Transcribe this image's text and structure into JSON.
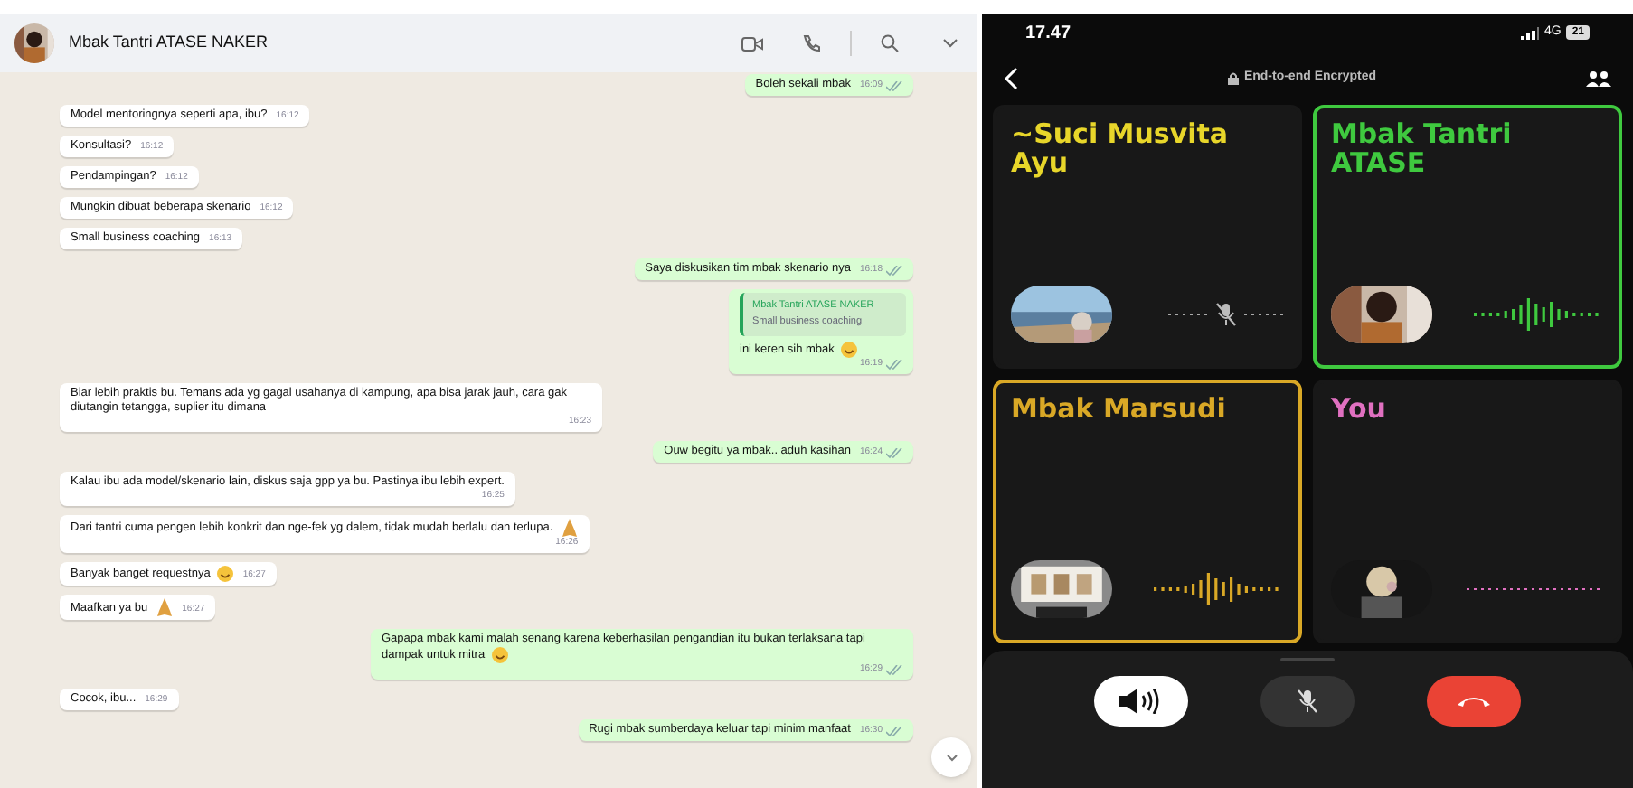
{
  "chat": {
    "title": "Mbak Tantri ATASE NAKER",
    "messages": [
      {
        "kind": "out",
        "text": "Boleh sekali mbak",
        "time": "16:09",
        "read": true
      },
      {
        "kind": "in",
        "text": "Model mentoringnya seperti apa, ibu?",
        "time": "16:12"
      },
      {
        "kind": "in",
        "text": "Konsultasi?",
        "time": "16:12"
      },
      {
        "kind": "in",
        "text": "Pendampingan?",
        "time": "16:12"
      },
      {
        "kind": "in",
        "text": "Mungkin dibuat beberapa skenario",
        "time": "16:12"
      },
      {
        "kind": "in",
        "text": "Small business coaching",
        "time": "16:13"
      },
      {
        "kind": "out",
        "text": "Saya diskusikan tim mbak skenario nya",
        "time": "16:18",
        "read": true
      },
      {
        "kind": "out",
        "quote_author": "Mbak Tantri ATASE NAKER",
        "quote": "Small business coaching",
        "text": "ini keren sih mbak",
        "emoji": {
          "kind": "smile"
        },
        "time": "16:19",
        "read": true
      },
      {
        "kind": "in",
        "text": "Biar lebih praktis bu. Temans ada yg gagal usahanya di kampung, apa bisa jarak jauh, cara gak diutangin tetangga, suplier itu dimana",
        "time": "16:23"
      },
      {
        "kind": "out",
        "text": "Ouw begitu ya mbak.. aduh kasihan",
        "time": "16:24",
        "read": true
      },
      {
        "kind": "in",
        "text": "Kalau ibu ada model/skenario lain, diskus saja gpp ya bu. Pastinya ibu lebih expert.",
        "time": "16:25"
      },
      {
        "kind": "in",
        "text": "Dari tantri cuma pengen lebih konkrit dan nge-fek yg dalem, tidak mudah berlalu dan terlupa.",
        "emoji": {
          "kind": "pray"
        },
        "time": "16:26"
      },
      {
        "kind": "in",
        "text": "Banyak banget requestnya",
        "emoji": {
          "kind": "smile"
        },
        "time": "16:27"
      },
      {
        "kind": "in",
        "text": "Maafkan ya bu",
        "emoji": {
          "kind": "pray"
        },
        "time": "16:27"
      },
      {
        "kind": "out",
        "text": "Gapapa mbak kami malah senang karena keberhasilan pengandian itu bukan terlaksana tapi dampak untuk mitra",
        "emoji": {
          "kind": "smile"
        },
        "time": "16:29",
        "read": true
      },
      {
        "kind": "in",
        "text": "Cocok, ibu...",
        "time": "16:29"
      },
      {
        "kind": "out",
        "text": "Rugi mbak sumberdaya keluar tapi minim manfaat",
        "time": "16:30",
        "read": true
      }
    ]
  },
  "call": {
    "time": "17.47",
    "network": "4G",
    "battery": "21",
    "header": "End-to-end Encrypted",
    "tiles": [
      {
        "name": "~Suci Musvita Ayu",
        "color": "#e8d62a",
        "highlighted": false,
        "audio": {
          "kind": "muted"
        }
      },
      {
        "name": "Mbak Tantri ATASE",
        "color": "#3fc93f",
        "highlighted": true,
        "audio": {
          "kind": "talking"
        }
      },
      {
        "name": "Mbak Marsudi",
        "color": "#d9a826",
        "highlighted": true,
        "audio": {
          "kind": "talking"
        }
      },
      {
        "name": "You",
        "color": "#e070c0",
        "highlighted": false,
        "audio": {
          "kind": "silent"
        }
      }
    ],
    "controls": [
      {
        "kind": "speaker",
        "on": true
      },
      {
        "kind": "mute",
        "on": false
      },
      {
        "kind": "end",
        "on": true
      }
    ]
  }
}
